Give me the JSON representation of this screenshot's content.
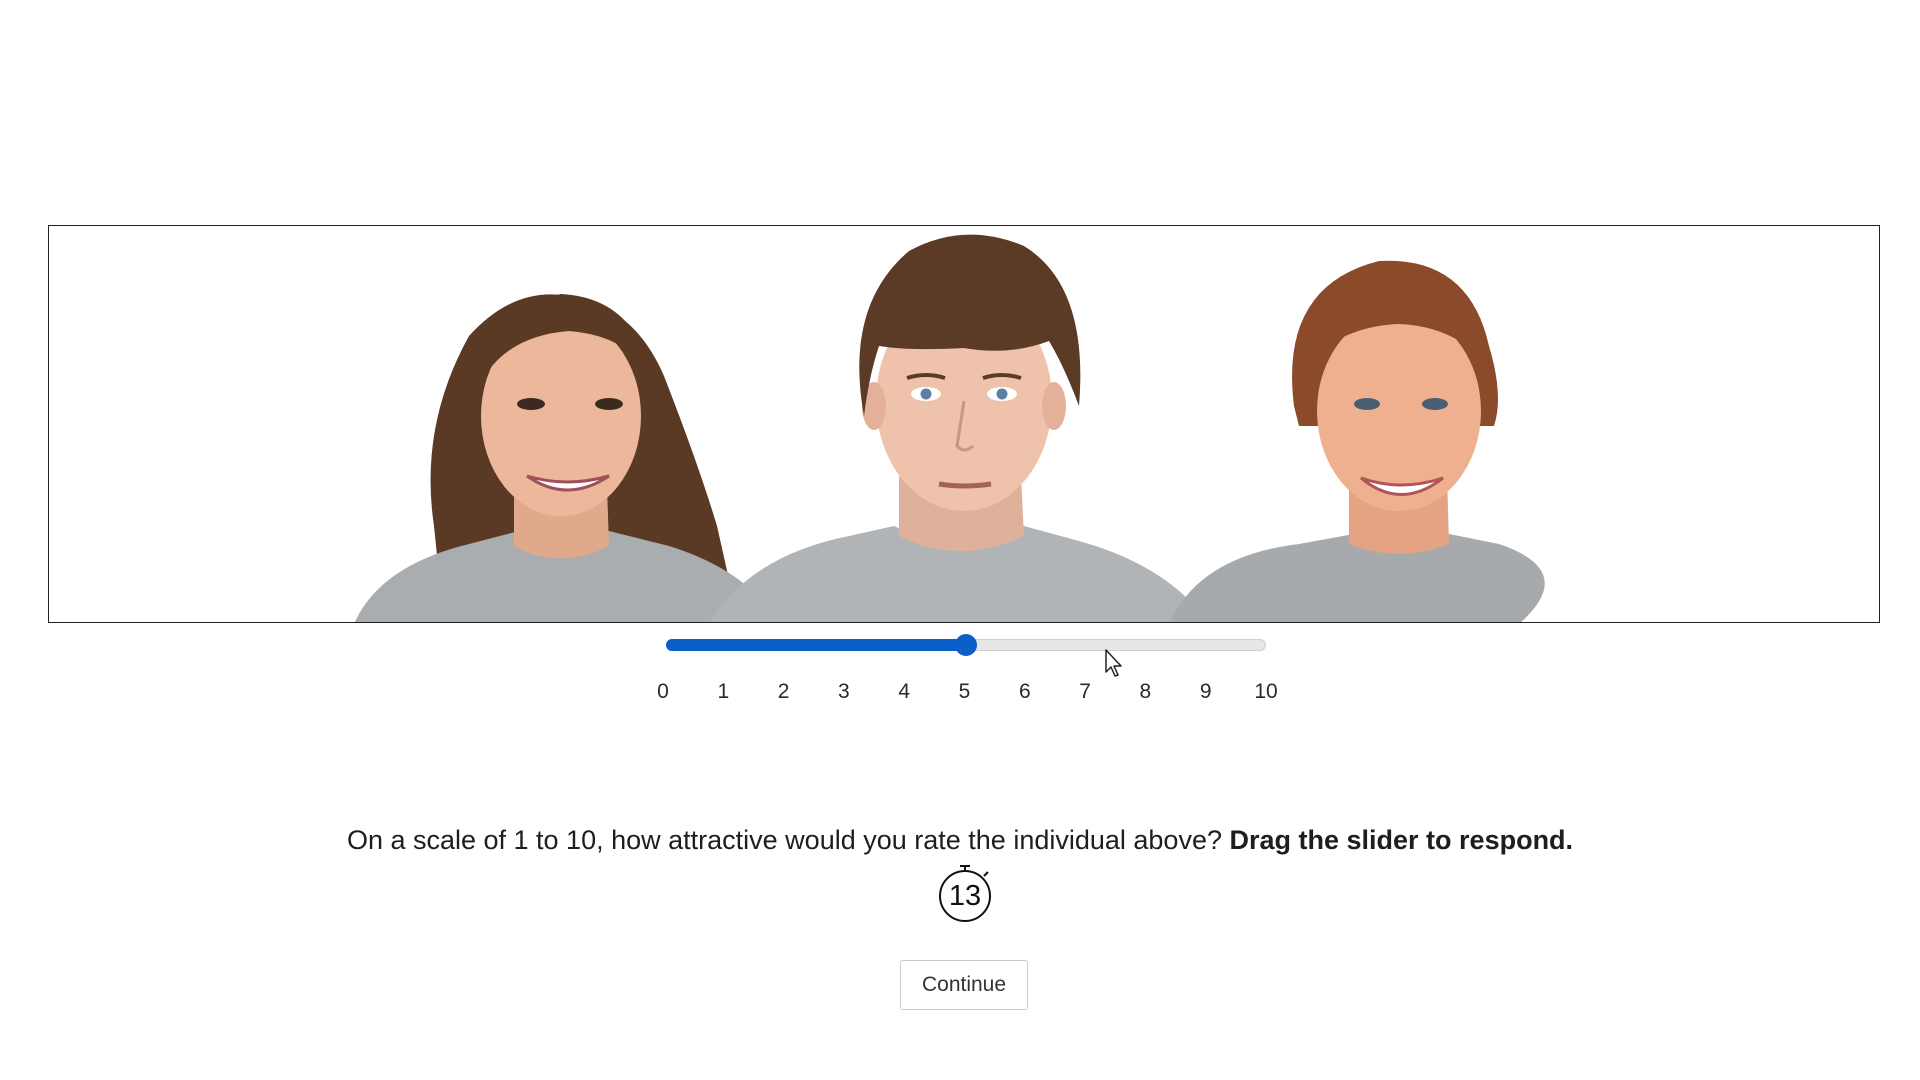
{
  "stimulus": {
    "faces": [
      {
        "name": "face-left",
        "description": "smiling young woman with long brown hair, grey t-shirt"
      },
      {
        "name": "face-center",
        "description": "young man with brown mop haircut, neutral expression, grey t-shirt"
      },
      {
        "name": "face-right",
        "description": "smiling woman with auburn hair pulled back, grey t-shirt"
      }
    ]
  },
  "slider": {
    "min": 0,
    "max": 10,
    "value": 5,
    "tick_labels": [
      "0",
      "1",
      "2",
      "3",
      "4",
      "5",
      "6",
      "7",
      "8",
      "9",
      "10"
    ],
    "accent_color": "#0a5fc8",
    "track_color": "#e6e6e6"
  },
  "question": {
    "text": "On a scale of 1 to 10, how attractive would you rate the individual above?",
    "instruction": "Drag the slider to respond."
  },
  "timer": {
    "icon": "stopwatch-icon",
    "value": "13"
  },
  "continue_button": {
    "label": "Continue"
  },
  "cursor": {
    "icon": "mouse-pointer-icon"
  }
}
